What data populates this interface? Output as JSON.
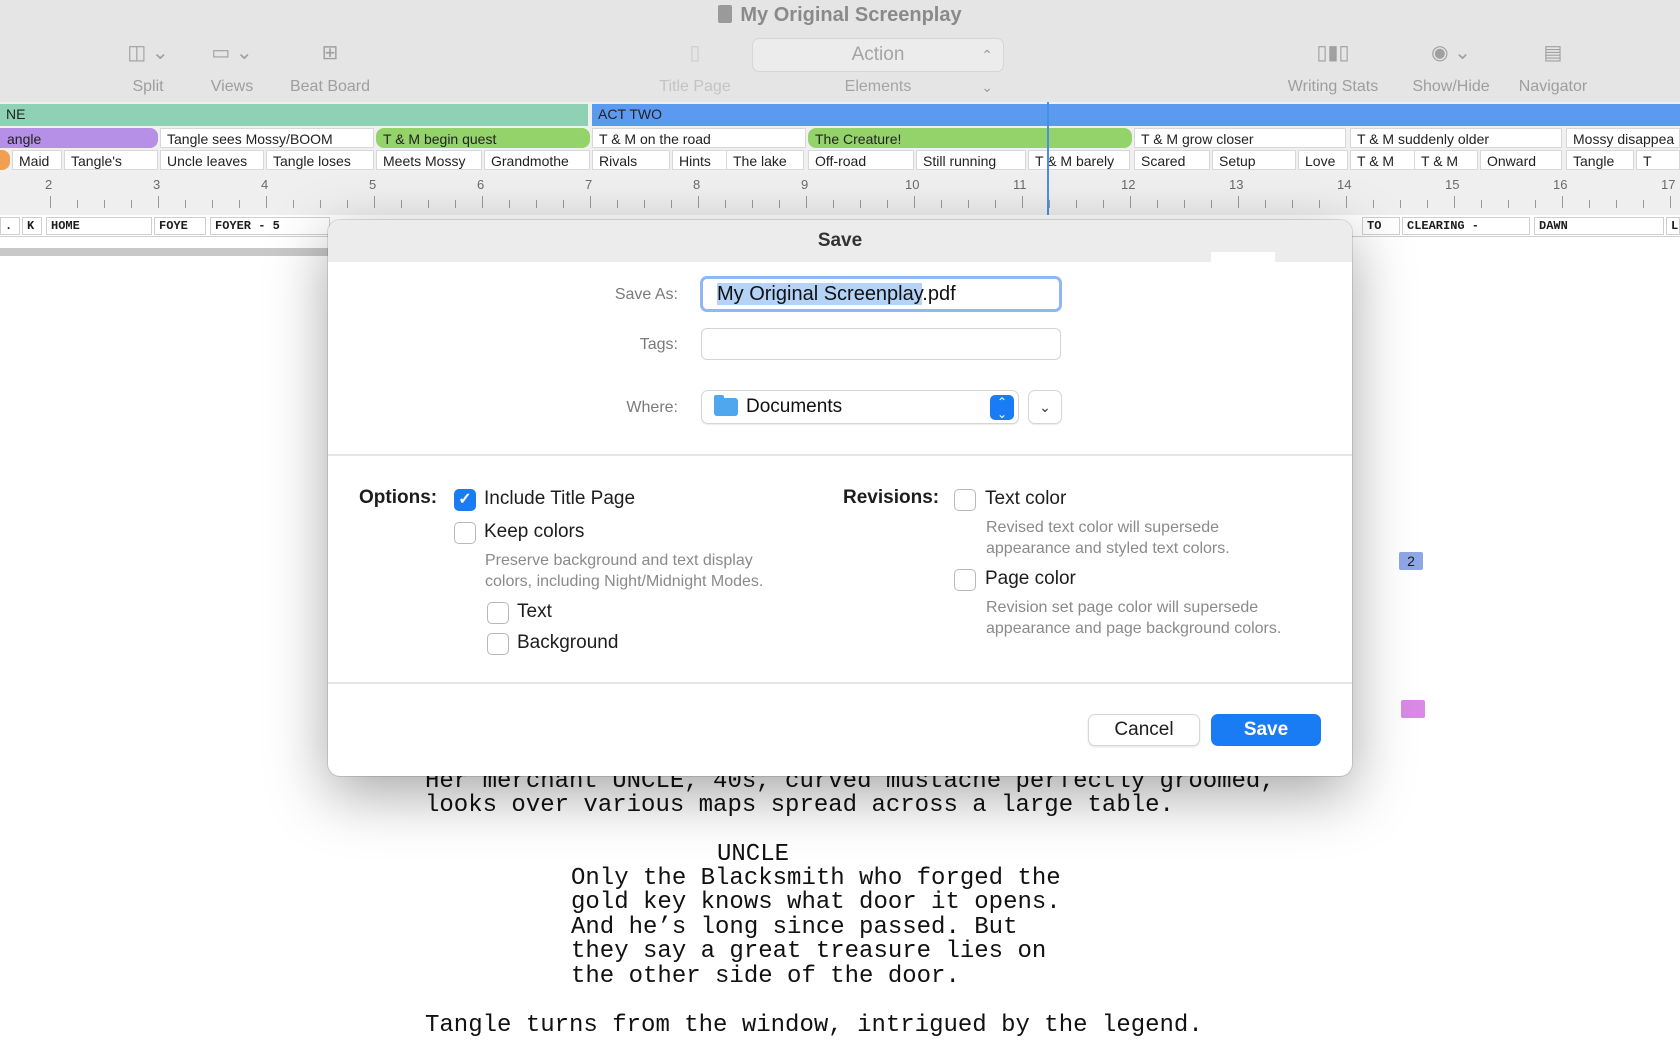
{
  "window": {
    "title": "My Original Screenplay"
  },
  "toolbar": {
    "split": {
      "label": "Split",
      "icon": "split-view-icon"
    },
    "views": {
      "label": "Views",
      "icon": "views-icon"
    },
    "beat_board": {
      "label": "Beat Board",
      "icon": "beat-board-icon"
    },
    "title_page": {
      "label": "Title Page",
      "icon": "title-page-icon"
    },
    "elements": {
      "label": "Elements",
      "selected": "Action"
    },
    "writing_stats": {
      "label": "Writing Stats",
      "icon": "bar-chart-icon"
    },
    "show_hide": {
      "label": "Show/Hide",
      "icon": "eye-icon"
    },
    "navigator": {
      "label": "Navigator",
      "icon": "navigator-icon"
    }
  },
  "timeline": {
    "acts": [
      "NE",
      "ACT TWO"
    ],
    "sequences": [
      "angle",
      "Tangle sees Mossy/BOOM",
      "T & M begin quest",
      "T & M on the road",
      "The Creature!",
      "T & M grow closer",
      "T & M suddenly older",
      "Mossy disappea"
    ],
    "scenes": [
      "Maid",
      "Tangle's",
      "Uncle leaves",
      "Tangle loses",
      "Meets Mossy",
      "Grandmothe",
      "Rivals",
      "Hints",
      "The lake",
      "Off-road",
      "Still running",
      "T & M barely",
      "Scared",
      "Setup",
      "Love",
      "T & M",
      "T & M",
      "Onward",
      "Tangle",
      "T"
    ],
    "ruler_numbers": [
      "2",
      "3",
      "4",
      "5",
      "6",
      "7",
      "8",
      "9",
      "10",
      "11",
      "12",
      "13",
      "14",
      "15",
      "16",
      "17"
    ],
    "colors": {
      "act_one": "#8fd1b4",
      "act_two": "#5b9af0",
      "purple": "#b68fe6",
      "green": "#94d26a",
      "orange": "#f0a050",
      "playhead": "#4a90e2"
    }
  },
  "scene_bar": {
    "left": [
      ".",
      "K",
      "HOME",
      "FOYE",
      "FOYER - 5"
    ],
    "right": [
      "TO",
      "CLEARING -",
      "DAWN",
      "L"
    ]
  },
  "script": {
    "action1_line1": "Her merchant UNCLE, 40s, curved mustache perfectly groomed,",
    "action1_line2": "looks over various maps spread across a large table.",
    "character": "UNCLE",
    "dialogue": [
      "Only the Blacksmith who forged the",
      "gold key knows what door it opens.",
      "And he’s long since passed. But",
      "they say a great treasure lies on",
      "the other side of the door."
    ],
    "action2": "Tangle turns from the window, intrigued by the legend.",
    "note_flag": "2"
  },
  "dialog": {
    "title": "Save",
    "save_as_label": "Save As:",
    "save_as_value_selected": "My Original Screenplay",
    "save_as_value_ext": ".pdf",
    "tags_label": "Tags:",
    "tags_value": "",
    "where_label": "Where:",
    "where_value": "Documents",
    "options_heading": "Options:",
    "options": {
      "include_title_page": {
        "label": "Include Title Page",
        "checked": true
      },
      "keep_colors": {
        "label": "Keep colors",
        "checked": false,
        "desc1": "Preserve background and text display",
        "desc2": "colors, including Night/Midnight Modes."
      },
      "text": {
        "label": "Text",
        "checked": false
      },
      "background": {
        "label": "Background",
        "checked": false
      }
    },
    "revisions_heading": "Revisions:",
    "revisions": {
      "text_color": {
        "label": "Text color",
        "checked": false,
        "desc1": "Revised text color will supersede",
        "desc2": "appearance and styled text colors."
      },
      "page_color": {
        "label": "Page color",
        "checked": false,
        "desc1": "Revision set page color will supersede",
        "desc2": "appearance and page background colors."
      }
    },
    "cancel_label": "Cancel",
    "save_label": "Save",
    "accent_color": "#1a7cf5"
  }
}
